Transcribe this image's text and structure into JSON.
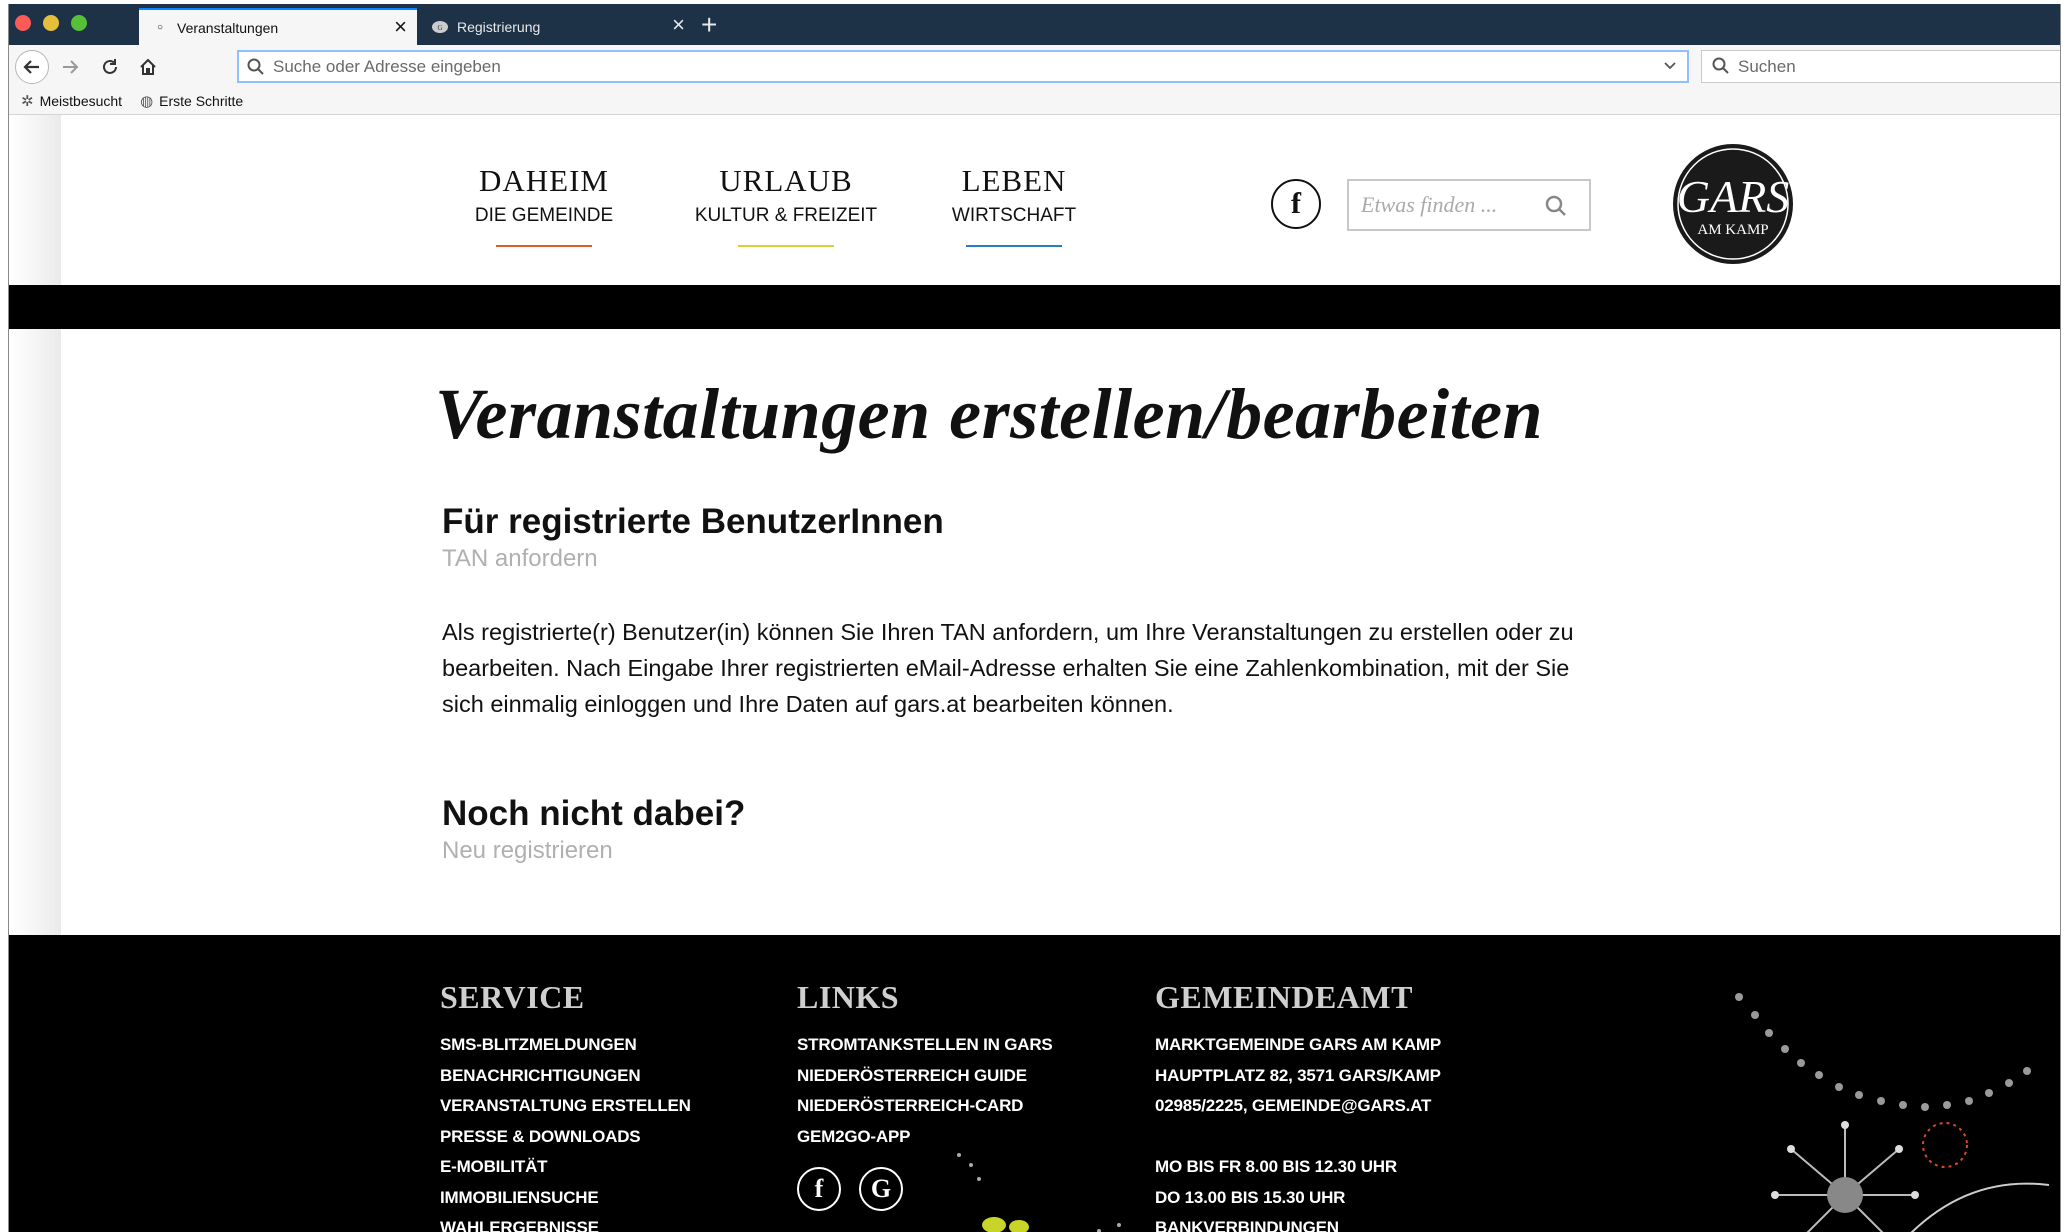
{
  "browser": {
    "tabs": [
      {
        "label": "Veranstaltungen"
      },
      {
        "label": "Registrierung"
      }
    ],
    "url_placeholder": "Suche oder Adresse eingeben",
    "search_placeholder": "Suchen",
    "bookmarks": [
      {
        "label": "Meistbesucht"
      },
      {
        "label": "Erste Schritte"
      }
    ]
  },
  "site": {
    "nav": [
      {
        "title": "DAHEIM",
        "subtitle": "DIE GEMEINDE",
        "color": "#e05a2b"
      },
      {
        "title": "URLAUB",
        "subtitle": "KULTUR & FREIZEIT",
        "color": "#d8d23a"
      },
      {
        "title": "LEBEN",
        "subtitle": "WIRTSCHAFT",
        "color": "#2a7fb8"
      }
    ],
    "search_placeholder": "Etwas finden ...",
    "logo": {
      "main": "GARS",
      "sub": "AM KAMP"
    }
  },
  "main": {
    "title": "Veranstaltungen erstellen/bearbeiten",
    "registered_heading": "Für registrierte BenutzerInnen",
    "tan_link": "TAN anfordern",
    "description": "Als registrierte(r) Benutzer(in) können Sie Ihren TAN anfordern, um Ihre Veranstaltungen zu erstellen oder zu bearbeiten. Nach Eingabe Ihrer registrierten eMail-Adresse erhalten Sie eine Zahlenkombination, mit der Sie sich einmalig einloggen und Ihre Daten auf gars.at bearbeiten können.",
    "new_heading": "Noch nicht dabei?",
    "register_link": "Neu registrieren"
  },
  "footer": {
    "service": {
      "title": "SERVICE",
      "items": [
        "SMS-BLITZMELDUNGEN",
        "BENACHRICHTIGUNGEN",
        "VERANSTALTUNG ERSTELLEN",
        "PRESSE & DOWNLOADS",
        "E-MOBILITÄT",
        "IMMOBILIENSUCHE",
        "WAHLERGEBNISSE"
      ]
    },
    "links": {
      "title": "LINKS",
      "items": [
        "STROMTANKSTELLEN IN GARS",
        "NIEDERÖSTERREICH GUIDE",
        "NIEDERÖSTERREICH-CARD",
        "GEM2GO-APP"
      ]
    },
    "gemeindeamt": {
      "title": "GEMEINDEAMT",
      "address": [
        "MARKTGEMEINDE GARS AM KAMP",
        "HAUPTPLATZ 82, 3571 GARS/KAMP",
        "02985/2225, GEMEINDE@GARS.AT"
      ],
      "hours": [
        "MO BIS FR 8.00 BIS 12.30 UHR",
        "DO 13.00 BIS 15.30 UHR",
        "BANKVERBINDUNGEN"
      ]
    }
  }
}
